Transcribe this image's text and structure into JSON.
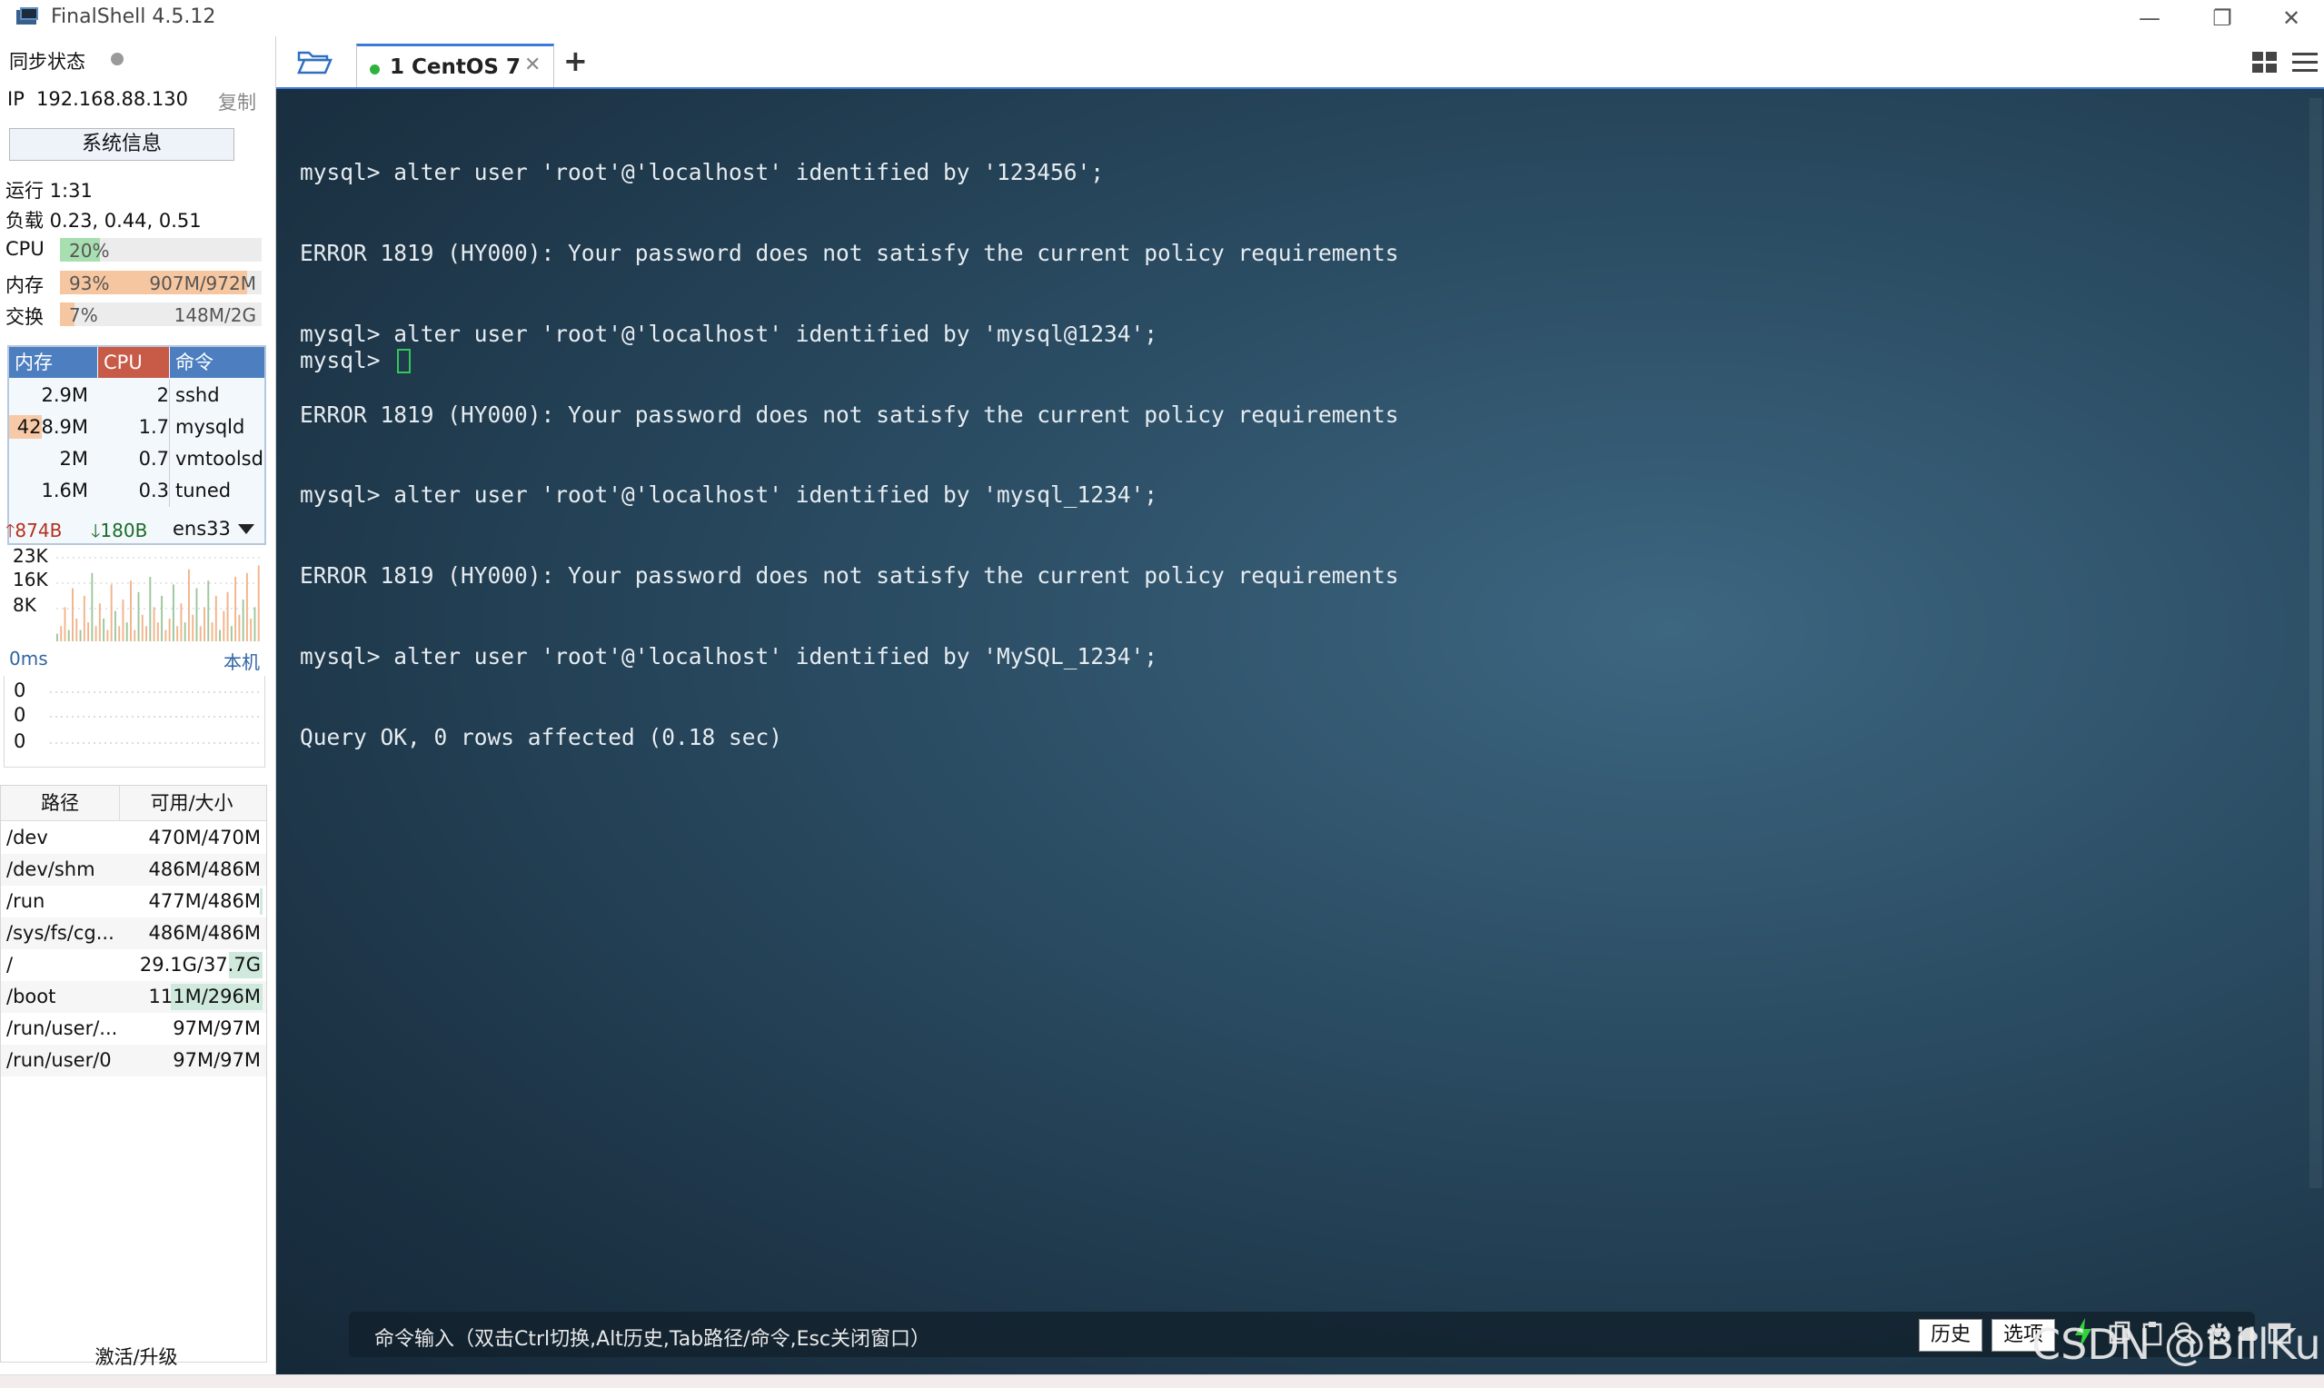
{
  "window": {
    "title": "FinalShell 4.5.12",
    "minimize": "—",
    "maximize": "❐",
    "close": "✕"
  },
  "sidebar": {
    "sync_label": "同步状态",
    "ip_label": "IP",
    "ip_value": "192.168.88.130",
    "copy_label": "复制",
    "sysinfo_button": "系统信息",
    "uptime": "运行 1:31",
    "load": "负载 0.23, 0.44, 0.51",
    "meters": [
      {
        "label": "CPU",
        "percent_text": "20%",
        "amount": "",
        "fill": 0.2,
        "color": "#a8dfb0"
      },
      {
        "label": "内存",
        "percent_text": "93%",
        "amount": "907M/972M",
        "fill": 0.93,
        "color": "#f6c6a0"
      },
      {
        "label": "交换",
        "percent_text": "7%",
        "amount": "148M/2G",
        "fill": 0.07,
        "color": "#f6c6a0"
      }
    ],
    "process_headers": {
      "mem": "内存",
      "cpu": "CPU",
      "cmd": "命令"
    },
    "processes": [
      {
        "mem": "2.9M",
        "cpu": "2",
        "cmd": "sshd",
        "mem_fill": 0.0
      },
      {
        "mem": "428.9M",
        "cpu": "1.7",
        "cmd": "mysqld",
        "mem_fill": 0.41
      },
      {
        "mem": "2M",
        "cpu": "0.7",
        "cmd": "vmtoolsd",
        "mem_fill": 0.0
      },
      {
        "mem": "1.6M",
        "cpu": "0.3",
        "cmd": "tuned",
        "mem_fill": 0.0
      }
    ],
    "network": {
      "up": "874B",
      "down": "180B",
      "interface": "ens33",
      "ticks": [
        "23K",
        "16K",
        "8K"
      ],
      "samples": [
        2,
        4,
        9,
        3,
        14,
        6,
        3,
        12,
        5,
        18,
        4,
        10,
        6,
        3,
        15,
        8,
        4,
        11,
        5,
        16,
        3,
        13,
        7,
        4,
        17,
        9,
        5,
        12,
        3,
        6,
        15,
        4,
        10,
        5,
        19,
        7,
        14,
        4,
        9,
        16,
        5,
        12,
        3,
        8,
        13,
        4,
        17,
        7,
        11,
        18,
        6,
        9,
        20
      ]
    },
    "ping": {
      "latency_label": "0ms",
      "host_label": "本机",
      "values": [
        "0",
        "0",
        "0"
      ]
    },
    "disk_headers": {
      "path": "路径",
      "size": "可用/大小"
    },
    "disks": [
      {
        "path": "/dev",
        "size": "470M/470M",
        "used": 0.0
      },
      {
        "path": "/dev/shm",
        "size": "486M/486M",
        "used": 0.0
      },
      {
        "path": "/run",
        "size": "477M/486M",
        "used": 0.02
      },
      {
        "path": "/sys/fs/cg...",
        "size": "486M/486M",
        "used": 0.0
      },
      {
        "path": "/",
        "size": "29.1G/37.7G",
        "used": 0.23
      },
      {
        "path": "/boot",
        "size": "111M/296M",
        "used": 0.63
      },
      {
        "path": "/run/user/...",
        "size": "97M/97M",
        "used": 0.0
      },
      {
        "path": "/run/user/0",
        "size": "97M/97M",
        "used": 0.0
      }
    ],
    "activate_label": "激活/升级"
  },
  "tabs": [
    {
      "label": "1  CentOS 7",
      "close": "✕",
      "status_color": "#2fb13e"
    }
  ],
  "add_tab": "+",
  "terminal": {
    "lines": [
      "mysql> alter user 'root'@'localhost' identified by '123456';",
      "ERROR 1819 (HY000): Your password does not satisfy the current policy requirements",
      "mysql> alter user 'root'@'localhost' identified by 'mysql@1234';",
      "ERROR 1819 (HY000): Your password does not satisfy the current policy requirements",
      "mysql> alter user 'root'@'localhost' identified by 'mysql_1234';",
      "ERROR 1819 (HY000): Your password does not satisfy the current policy requirements",
      "mysql> alter user 'root'@'localhost' identified by 'MySQL_1234';",
      "Query OK, 0 rows affected (0.18 sec)"
    ],
    "prompt": "mysql> "
  },
  "command_bar": {
    "hint": "命令输入（双击Ctrl切换,Alt历史,Tab路径/命令,Esc关闭窗口）",
    "history_button": "历史",
    "options_button": "选项"
  },
  "watermark": "CSDN @BillKu",
  "icons": [
    "app-icon",
    "folder-icon",
    "layout-grid-icon",
    "hamburger-menu-icon",
    "bolt-icon",
    "copy-icon",
    "paste-icon",
    "search-icon",
    "gear-icon",
    "cloud-icon",
    "window-icon",
    "caret-down-icon"
  ]
}
